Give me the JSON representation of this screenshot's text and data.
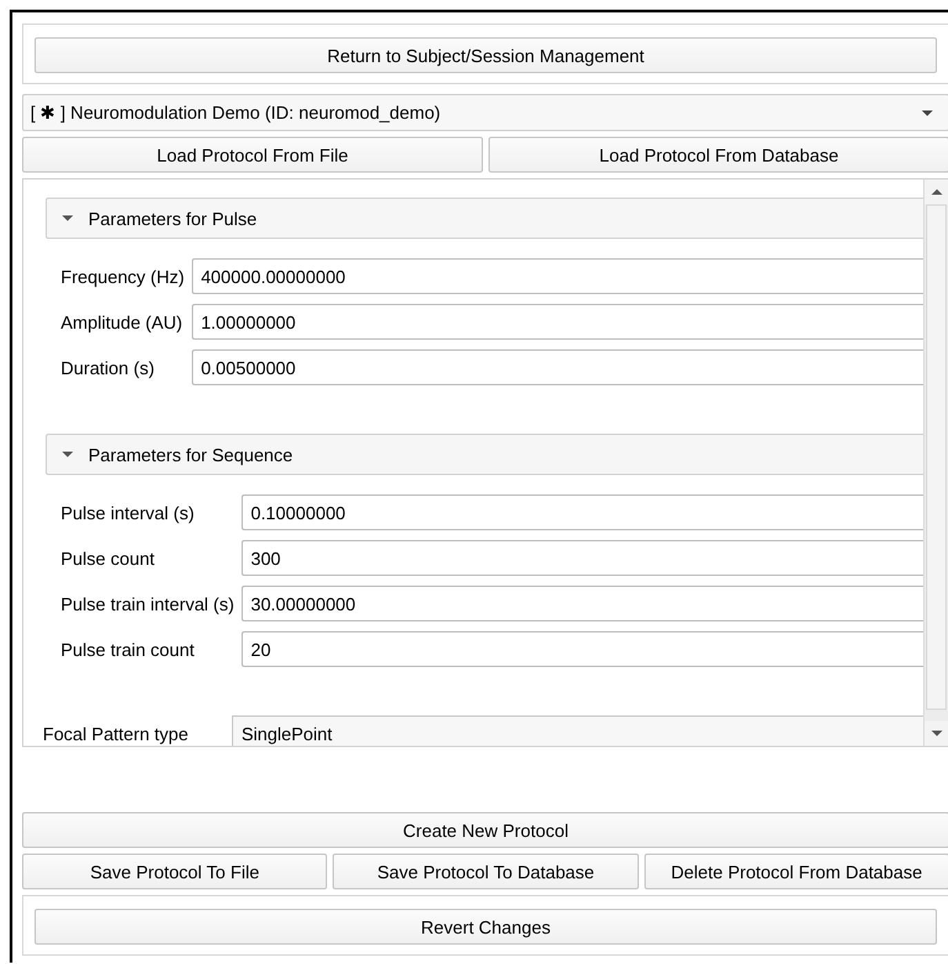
{
  "return_button": "Return to Subject/Session Management",
  "protocol_select": "[ ✱ ] Neuromodulation Demo (ID: neuromod_demo)",
  "load_buttons": [
    "Load Protocol From File",
    "Load Protocol From Database"
  ],
  "sections": [
    {
      "title": "Parameters for Pulse",
      "expanded": true,
      "fields": [
        {
          "label": "Frequency (Hz)",
          "value": "400000.00000000"
        },
        {
          "label": "Amplitude (AU)",
          "value": "1.00000000"
        },
        {
          "label": "Duration (s)",
          "value": "0.00500000"
        }
      ]
    },
    {
      "title": "Parameters for Sequence",
      "expanded": true,
      "fields": [
        {
          "label": "Pulse interval (s)",
          "value": "0.10000000"
        },
        {
          "label": "Pulse count",
          "value": "300"
        },
        {
          "label": "Pulse train interval (s)",
          "value": "30.00000000"
        },
        {
          "label": "Pulse train count",
          "value": "20"
        }
      ]
    }
  ],
  "focal_pattern": {
    "label": "Focal Pattern type",
    "value": "SinglePoint"
  },
  "create_button": "Create New Protocol",
  "action_buttons": [
    "Save Protocol To File",
    "Save Protocol To Database",
    "Delete Protocol From Database"
  ],
  "revert_button": "Revert Changes"
}
